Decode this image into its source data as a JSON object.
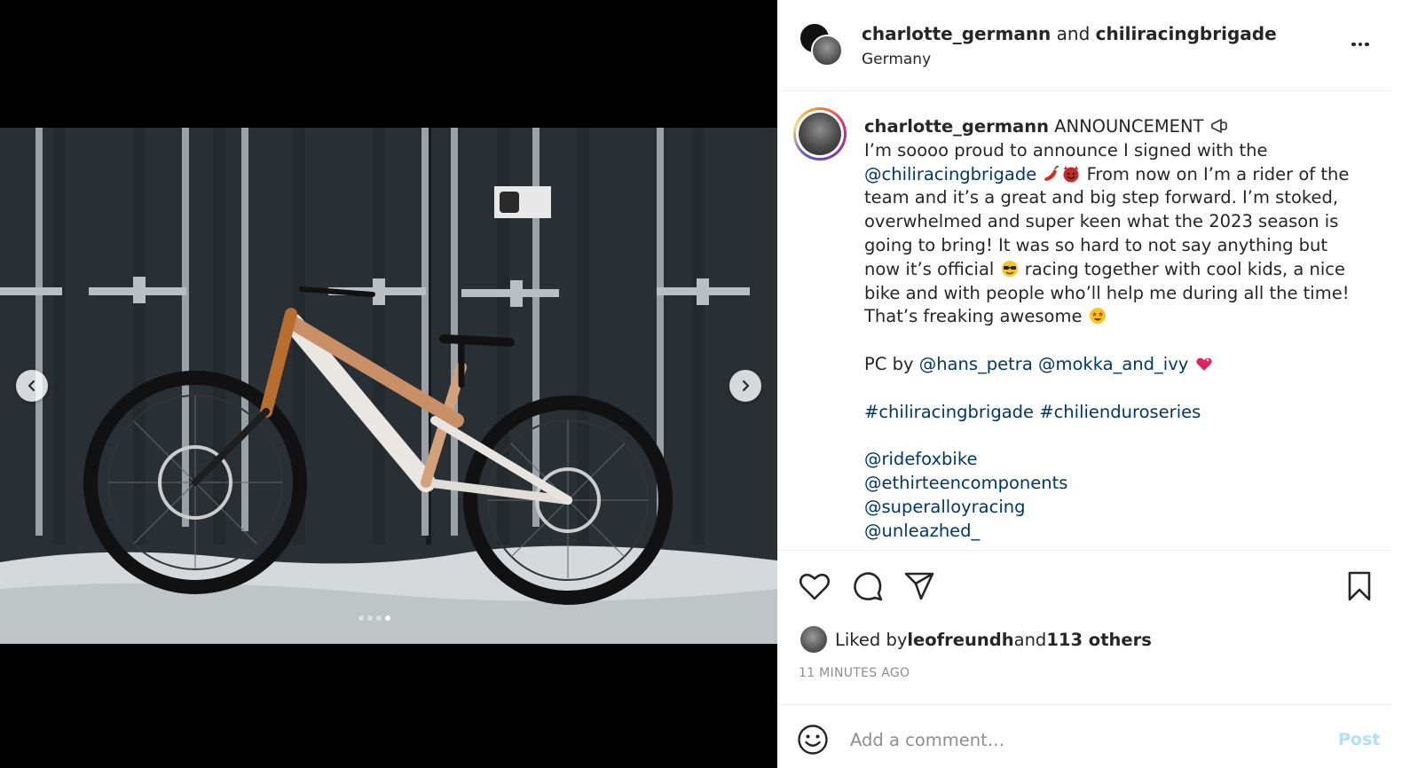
{
  "media": {
    "image_alt": "Commencal mountain bike with Schwalbe tires leaning against a dark shipping container in snow",
    "carousel": {
      "count": 4,
      "active": 3
    },
    "prev_icon": "chevron-left-icon",
    "next_icon": "chevron-right-icon"
  },
  "header": {
    "user1": "charlotte_germann",
    "joiner": " and ",
    "user2": "chiliracingbrigade",
    "location": "Germany",
    "more_icon": "more-horizontal-icon"
  },
  "caption": {
    "username": "charlotte_germann",
    "title": "ANNOUNCEMENT",
    "line1": "I’m soooo proud to announce I signed with the",
    "mention_team": "@chiliracingbrigade",
    "text2": " From now on I’m a rider of the team and it’s a great and big step forward. I’m stoked, overwhelmed and super keen what the 2023 season is going to bring! It was so hard to not say anything but now it’s official ",
    "text3": " racing together with cool kids, a nice bike and with people who’ll help me during all the time! That’s freaking awesome ",
    "pc_label": "PC by ",
    "pc_mentions": [
      "@hans_petra",
      "@mokka_and_ivy"
    ],
    "hashtags": [
      "#chiliracingbrigade",
      "#chilienduroseries"
    ],
    "sponsors": [
      "@ridefoxbike",
      "@ethirteencomponents",
      "@superalloyracing",
      "@unleazhed_"
    ]
  },
  "actions": {
    "like_icon": "heart-icon",
    "comment_icon": "comment-icon",
    "share_icon": "paper-plane-icon",
    "save_icon": "bookmark-icon"
  },
  "likes": {
    "prefix": "Liked by ",
    "user": "leofreundh",
    "middle": " and ",
    "others": "113 others"
  },
  "timestamp": "11 MINUTES AGO",
  "comment": {
    "placeholder": "Add a comment…",
    "post_label": "Post",
    "emoji_icon": "smiley-icon"
  },
  "colors": {
    "link": "#00376b",
    "post_disabled": "#b2dffc",
    "muted": "#8e8e8e",
    "text": "#262626"
  }
}
